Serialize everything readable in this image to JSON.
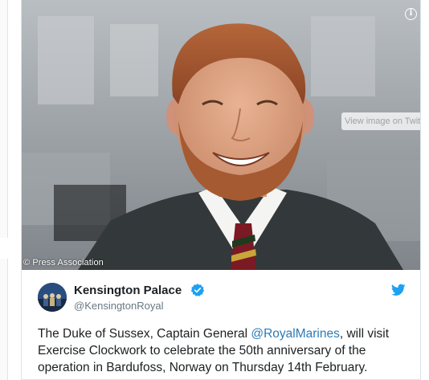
{
  "photo": {
    "credit": "© Press Association",
    "view_image_label": "View image on Twitter",
    "info_icon": "info-icon"
  },
  "tweet": {
    "display_name": "Kensington Palace",
    "handle": "@KensingtonRoyal",
    "verified_icon": "verified-badge-icon",
    "bird_icon": "twitter-bird-icon",
    "text_before": "The Duke of Sussex, Captain General ",
    "mention": "@RoyalMarines",
    "text_after": ", will visit Exercise Clockwork to celebrate the 50th anniversary of the operation in Bardufoss, Norway on Thursday 14th February."
  },
  "colors": {
    "link": "#2b7bb9",
    "twitter_blue": "#1da1f2",
    "text": "#1c2022",
    "muted": "#697882"
  }
}
